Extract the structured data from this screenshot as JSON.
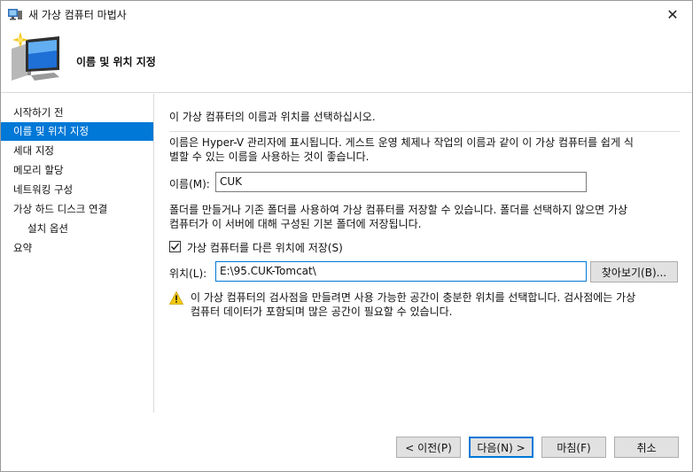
{
  "window": {
    "title": "새 가상 컴퓨터 마법사",
    "close_glyph": "✕"
  },
  "header": {
    "title": "이름 및 위치 지정",
    "icon": "computer-monitor-icon"
  },
  "sidebar": {
    "items": [
      {
        "label": "시작하기 전"
      },
      {
        "label": "이름 및 위치 지정"
      },
      {
        "label": "세대 지정"
      },
      {
        "label": "메모리 할당"
      },
      {
        "label": "네트워킹 구성"
      },
      {
        "label": "가상 하드 디스크 연결"
      },
      {
        "label": "설치 옵션"
      },
      {
        "label": "요약"
      }
    ],
    "active_index": 1
  },
  "content": {
    "intro": "이 가상 컴퓨터의 이름과 위치를 선택하십시오.",
    "name_desc_line1": "이름은 Hyper-V 관리자에 표시됩니다. 게스트 운영 체제나 작업의 이름과 같이 이 가상 컴퓨터를 쉽게 식",
    "name_desc_line2": "별할 수 있는 이름을 사용하는 것이 좋습니다.",
    "name_label": "이름(M):",
    "name_value": "CUK",
    "folder_desc_line1": "폴더를 만들거나 기존 폴더를 사용하여 가상 컴퓨터를 저장할 수 있습니다. 폴더를 선택하지 않으면 가상",
    "folder_desc_line2": "컴퓨터가 이 서버에 대해 구성된 기본 폴더에 저장됩니다.",
    "store_checkbox_label": "가상 컴퓨터를 다른 위치에 저장(S)",
    "store_checked": true,
    "location_label": "위치(L):",
    "location_value": "E:\\95.CUK-Tomcat\\",
    "browse_label": "찾아보기(B)...",
    "warning_line1": "이 가상 컴퓨터의 검사점을 만들려면 사용 가능한 공간이 충분한 위치를 선택합니다. 검사점에는 가상",
    "warning_line2": "컴퓨터 데이터가 포함되며 많은 공간이 필요할 수 있습니다."
  },
  "footer": {
    "prev_label": "< 이전(P)",
    "next_label": "다음(N) >",
    "finish_label": "마침(F)",
    "cancel_label": "취소"
  },
  "colors": {
    "accent": "#0078d7",
    "warning": "#f2c811"
  }
}
